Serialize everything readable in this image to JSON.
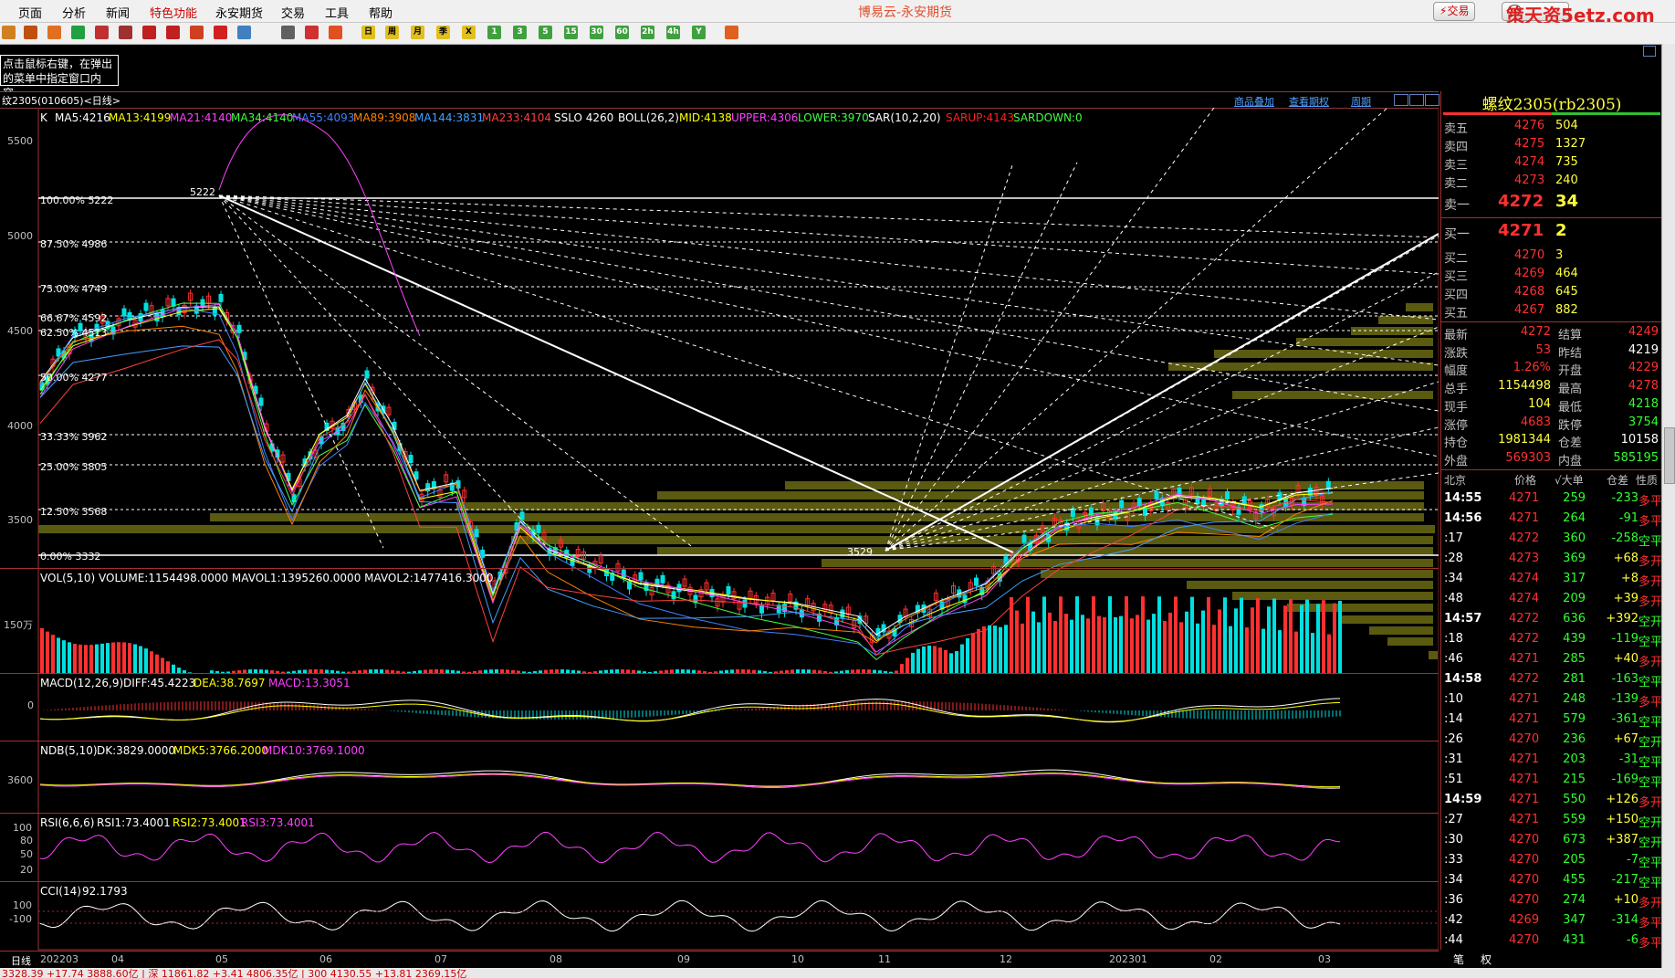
{
  "menu": [
    "页面",
    "分析",
    "新闻",
    "特色功能",
    "永安期货",
    "交易",
    "工具",
    "帮助"
  ],
  "app_title": "博易云-永安期货",
  "top_buttons": {
    "trade": "交易",
    "watermark": "策天资5etz.com"
  },
  "hint_text": "点击鼠标右键，在弹出的菜单中指定窗口内容。",
  "chart": {
    "symbol_label": "纹2305(010605)<日线>",
    "links": [
      "商品叠加",
      "查看期权",
      "周期"
    ],
    "main_ind": {
      "k": "K",
      "ma5": "MA5:4216",
      "ma13": "MA13:4199",
      "ma21": "MA21:4140",
      "ma34": "MA34:4140",
      "ma55": "MA55:4093",
      "ma89": "MA89:3908",
      "ma144": "MA144:3831",
      "ma233": "MA233:4104",
      "sslo": "SSLO 4260",
      "boll": "BOLL(26,2)",
      "mid": "MID:4138",
      "upper": "UPPER:4306",
      "lower": "LOWER:3970",
      "sar": "SAR(10,2,20)",
      "sarup": "SARUP:4143",
      "sardown": "SARDOWN:0"
    },
    "y_ticks": [
      "5500",
      "5000",
      "4500",
      "4000",
      "3500"
    ],
    "fib_labels": [
      "100.00%  5222",
      "87.50%  4986",
      "75.00%  4749",
      "66.67%  4592",
      "62.50%  4513",
      "50.00%  4277",
      "33.33%  3962",
      "25.00%  3805",
      "12.50%  3568",
      "0.00%  3332"
    ],
    "high_label": "5222",
    "low_label": "3529",
    "vol_ind": "VOL(5,10)  VOLUME:1154498.0000  MAVOL1:1395260.0000  MAVOL2:1477416.3000",
    "vol_tick": "150万",
    "macd": {
      "name": "MACD(12,26,9)",
      "diff": "DIFF:45.4223",
      "dea": "DEA:38.7697",
      "macd": "MACD:13.3051",
      "tick": "0"
    },
    "ndb": {
      "name": "NDB(5,10)",
      "dk": "DK:3829.0000",
      "mdk5": "MDK5:3766.2000",
      "mdk10": "MDK10:3769.1000",
      "tick": "3600"
    },
    "rsi": {
      "name": "RSI(6,6,6)",
      "r1": "RSI1:73.4001",
      "r2": "RSI2:73.4001",
      "r3": "RSI3:73.4001",
      "ticks": [
        "100",
        "80",
        "50",
        "20"
      ]
    },
    "cci": {
      "name": "CCI(14)",
      "val": "92.1793",
      "ticks": [
        "100",
        "-100"
      ]
    },
    "x_labels": [
      "日线",
      "202203",
      "04",
      "05",
      "06",
      "07",
      "08",
      "09",
      "10",
      "11",
      "12",
      "202301",
      "02",
      "03"
    ]
  },
  "quote": {
    "title": "螺纹2305(rb2305)",
    "asks": [
      {
        "label": "卖五",
        "price": "4276",
        "vol": "504"
      },
      {
        "label": "卖四",
        "price": "4275",
        "vol": "1327"
      },
      {
        "label": "卖三",
        "price": "4274",
        "vol": "735"
      },
      {
        "label": "卖二",
        "price": "4273",
        "vol": "240"
      }
    ],
    "ask1": {
      "label": "卖一",
      "price": "4272",
      "vol": "34"
    },
    "bid1": {
      "label": "买一",
      "price": "4271",
      "vol": "2"
    },
    "bids": [
      {
        "label": "买二",
        "price": "4270",
        "vol": "3"
      },
      {
        "label": "买三",
        "price": "4269",
        "vol": "464"
      },
      {
        "label": "买四",
        "price": "4268",
        "vol": "645"
      },
      {
        "label": "买五",
        "price": "4267",
        "vol": "882"
      }
    ],
    "stats": [
      {
        "l1": "最新",
        "v1": "4272",
        "l2": "结算",
        "v2": "4249"
      },
      {
        "l1": "涨跌",
        "v1": "53",
        "l2": "昨结",
        "v2": "4219"
      },
      {
        "l1": "幅度",
        "v1": "1.26%",
        "l2": "开盘",
        "v2": "4229"
      },
      {
        "l1": "总手",
        "v1": "1154498",
        "l2": "最高",
        "v2": "4278"
      },
      {
        "l1": "现手",
        "v1": "104",
        "l2": "最低",
        "v2": "4218"
      },
      {
        "l1": "涨停",
        "v1": "4683",
        "l2": "跌停",
        "v2": "3754"
      },
      {
        "l1": "持仓",
        "v1": "1981344",
        "l2": "仓差",
        "v2": "10158"
      },
      {
        "l1": "外盘",
        "v1": "569303",
        "l2": "内盘",
        "v2": "585195"
      }
    ],
    "tick_header": {
      "loc": "北京",
      "price": "价格",
      "vol": "√大单",
      "chg": "仓差",
      "nature": "性质"
    },
    "ticks": [
      {
        "t": "14:55",
        "p": "4271",
        "v": "259",
        "c": "-233",
        "n": "多平"
      },
      {
        "t": "14:56",
        "p": "4271",
        "v": "264",
        "c": "-91",
        "n": "多平"
      },
      {
        "t": ":17",
        "p": "4272",
        "v": "360",
        "c": "-258",
        "n": "空平"
      },
      {
        "t": ":28",
        "p": "4273",
        "v": "369",
        "c": "+68",
        "n": "多开"
      },
      {
        "t": ":34",
        "p": "4274",
        "v": "317",
        "c": "+8",
        "n": "多开"
      },
      {
        "t": ":48",
        "p": "4274",
        "v": "209",
        "c": "+39",
        "n": "多开"
      },
      {
        "t": "14:57",
        "p": "4272",
        "v": "636",
        "c": "+392",
        "n": "空开"
      },
      {
        "t": ":18",
        "p": "4272",
        "v": "439",
        "c": "-119",
        "n": "空平"
      },
      {
        "t": ":46",
        "p": "4271",
        "v": "285",
        "c": "+40",
        "n": "多开"
      },
      {
        "t": "14:58",
        "p": "4272",
        "v": "281",
        "c": "-163",
        "n": "空平"
      },
      {
        "t": ":10",
        "p": "4271",
        "v": "248",
        "c": "-139",
        "n": "多平"
      },
      {
        "t": ":14",
        "p": "4271",
        "v": "579",
        "c": "-361",
        "n": "空平"
      },
      {
        "t": ":26",
        "p": "4270",
        "v": "236",
        "c": "+67",
        "n": "空开"
      },
      {
        "t": ":31",
        "p": "4271",
        "v": "203",
        "c": "-31",
        "n": "空平"
      },
      {
        "t": ":51",
        "p": "4271",
        "v": "215",
        "c": "-169",
        "n": "空平"
      },
      {
        "t": "14:59",
        "p": "4271",
        "v": "550",
        "c": "+126",
        "n": "多开"
      },
      {
        "t": ":27",
        "p": "4271",
        "v": "559",
        "c": "+150",
        "n": "空开"
      },
      {
        "t": ":30",
        "p": "4270",
        "v": "673",
        "c": "+387",
        "n": "空开"
      },
      {
        "t": ":33",
        "p": "4270",
        "v": "205",
        "c": "-7",
        "n": "空平"
      },
      {
        "t": ":34",
        "p": "4270",
        "v": "455",
        "c": "-217",
        "n": "空平"
      },
      {
        "t": ":36",
        "p": "4270",
        "v": "274",
        "c": "+10",
        "n": "多开"
      },
      {
        "t": ":42",
        "p": "4269",
        "v": "347",
        "c": "-314",
        "n": "多平"
      },
      {
        "t": ":44",
        "p": "4270",
        "v": "431",
        "c": "-6",
        "n": "多平"
      }
    ],
    "tabs": [
      "笔",
      "权"
    ]
  },
  "status": "3328.39   +17.74  3888.60亿 | 深 11861.82   +3.41  4806.35亿 | 300 4130.55   +13.81  2369.15亿"
}
